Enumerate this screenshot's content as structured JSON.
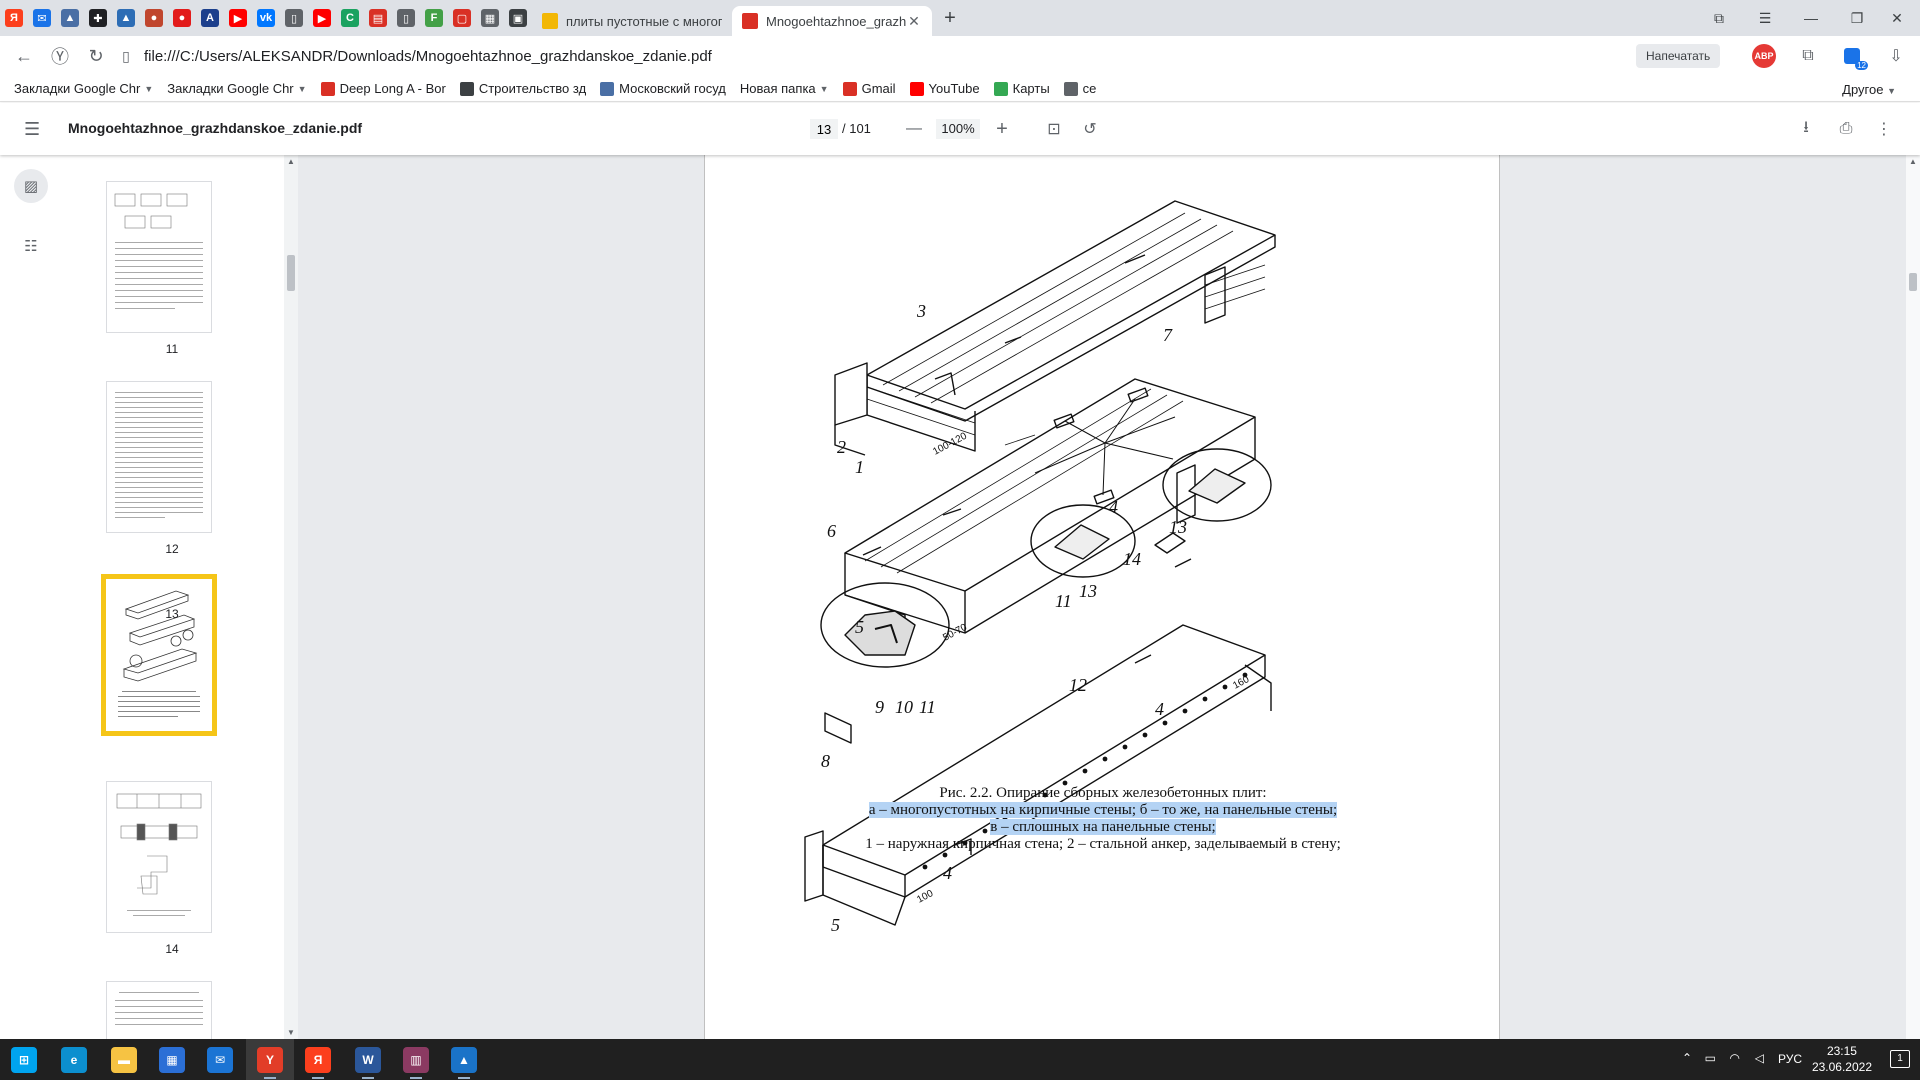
{
  "browser": {
    "pinned_icons": [
      {
        "name": "yandex-icon",
        "glyph": "Я",
        "color": "#fc3f1d"
      },
      {
        "name": "mail-icon",
        "glyph": "✉",
        "color": "#1a73e8"
      },
      {
        "name": "triangle-icon",
        "glyph": "▲",
        "color": "#4a6fa5"
      },
      {
        "name": "plus-star-icon",
        "glyph": "✚",
        "color": "#202124"
      },
      {
        "name": "drive-icon",
        "glyph": "▲",
        "color": "#2d6db5"
      },
      {
        "name": "browser-icon",
        "glyph": "●",
        "color": "#c0462e"
      },
      {
        "name": "red-dot-icon",
        "glyph": "●",
        "color": "#e21b1b"
      },
      {
        "name": "app-a-icon",
        "glyph": "A",
        "color": "#1c3f8c"
      },
      {
        "name": "youtube-icon",
        "glyph": "▶",
        "color": "#ff0000"
      },
      {
        "name": "vk-icon",
        "glyph": "vk",
        "color": "#0077ff"
      },
      {
        "name": "document-icon",
        "glyph": "▯",
        "color": "#5f6368"
      },
      {
        "name": "youtube-icon",
        "glyph": "▶",
        "color": "#ff0000"
      },
      {
        "name": "c-app-icon",
        "glyph": "C",
        "color": "#1aa260"
      },
      {
        "name": "pdf-icon",
        "glyph": "▤",
        "color": "#d93025"
      },
      {
        "name": "document-icon",
        "glyph": "▯",
        "color": "#5f6368"
      },
      {
        "name": "f-app-icon",
        "glyph": "F",
        "color": "#43a047"
      },
      {
        "name": "note-icon",
        "glyph": "▢",
        "color": "#d93025"
      },
      {
        "name": "grid-app-icon",
        "glyph": "▦",
        "color": "#5f6368"
      },
      {
        "name": "reader-icon",
        "glyph": "▣",
        "color": "#3c4043"
      }
    ],
    "tabs": [
      {
        "title": "плиты пустотные с многопустот",
        "active": false,
        "favicon_color": "#f2b705"
      },
      {
        "title": "Mnogoehtazhnoe_grazhdanskoe",
        "active": true,
        "favicon_color": "#d93025"
      }
    ],
    "new_tab_glyph": "+",
    "url": "file:///C:/Users/ALEKSANDR/Downloads/Mnogoehtazhnoe_grazhdanskoe_zdanie.pdf",
    "print_label": "Напечатать",
    "ext_badge": "12",
    "abp_label": "ABP",
    "bookmarks": [
      {
        "label": "Закладки Google Chr",
        "icon_color": "",
        "chevron": true
      },
      {
        "label": "Закладки Google Chr",
        "icon_color": "",
        "chevron": true
      },
      {
        "label": "Deep Long A - Bor",
        "icon_color": "#d93025",
        "chevron": false
      },
      {
        "label": "Строительство зд",
        "icon_color": "#3c4043",
        "chevron": false
      },
      {
        "label": "Московский госуд",
        "icon_color": "#4a6fa5",
        "chevron": false
      },
      {
        "label": "Новая папка",
        "icon_color": "",
        "chevron": true
      },
      {
        "label": "Gmail",
        "icon_color": "#d93025",
        "chevron": false
      },
      {
        "label": "YouTube",
        "icon_color": "#ff0000",
        "chevron": false
      },
      {
        "label": "Карты",
        "icon_color": "#34a853",
        "chevron": false
      },
      {
        "label": "ce",
        "icon_color": "#5f6368",
        "chevron": false
      }
    ],
    "other_bookmarks": "Другое"
  },
  "pdf": {
    "title": "Mnogoehtazhnoe_grazhdanskoe_zdanie.pdf",
    "current_page": "13",
    "total_pages": "/ 101",
    "zoom": "100%",
    "thumbnails": [
      {
        "label": "11",
        "selected": false
      },
      {
        "label": "12",
        "selected": false
      },
      {
        "label": "13",
        "selected": true
      },
      {
        "label": "14",
        "selected": false
      },
      {
        "label": "",
        "selected": false
      }
    ],
    "figure_labels": [
      "1",
      "2",
      "3",
      "4",
      "4",
      "4",
      "5",
      "5",
      "6",
      "7",
      "8",
      "9",
      "10",
      "11",
      "11",
      "12",
      "13",
      "13",
      "14",
      "100",
      "160",
      "100-120",
      "50-70"
    ],
    "caption": {
      "title": "Рис. 2.2. Опирание сборных железобетонных плит:",
      "line2": "а – многопустотных на кирпичные стены; б – то же, на панельные стены;",
      "line3": "в – сплошных на панельные стены;",
      "line4": "1 – наружная кирпичная стена; 2 – стальной анкер, заделываемый в стену;"
    }
  },
  "taskbar": {
    "apps": [
      {
        "name": "windows-start-icon",
        "glyph": "⊞",
        "color": "#00a4ef",
        "running": false,
        "active": false
      },
      {
        "name": "edge-icon",
        "glyph": "e",
        "color": "#0c8fcf",
        "running": false,
        "active": false
      },
      {
        "name": "file-explorer-icon",
        "glyph": "▬",
        "color": "#f6c343",
        "running": false,
        "active": false
      },
      {
        "name": "store-icon",
        "glyph": "▦",
        "color": "#2b6fd6",
        "running": false,
        "active": false
      },
      {
        "name": "mail-icon",
        "glyph": "✉",
        "color": "#1b74d4",
        "running": false,
        "active": false
      },
      {
        "name": "yandex-browser-icon",
        "glyph": "Y",
        "color": "#e23d28",
        "running": true,
        "active": true
      },
      {
        "name": "yandex-icon",
        "glyph": "Я",
        "color": "#fc3f1d",
        "running": true,
        "active": false
      },
      {
        "name": "word-icon",
        "glyph": "W",
        "color": "#2b579a",
        "running": true,
        "active": false
      },
      {
        "name": "winrar-icon",
        "glyph": "▥",
        "color": "#8b3a62",
        "running": true,
        "active": false
      },
      {
        "name": "photos-icon",
        "glyph": "▲",
        "color": "#1a73c8",
        "running": true,
        "active": false
      }
    ],
    "language": "РУС",
    "time": "23:15",
    "date": "23.06.2022",
    "notif_count": "1"
  }
}
